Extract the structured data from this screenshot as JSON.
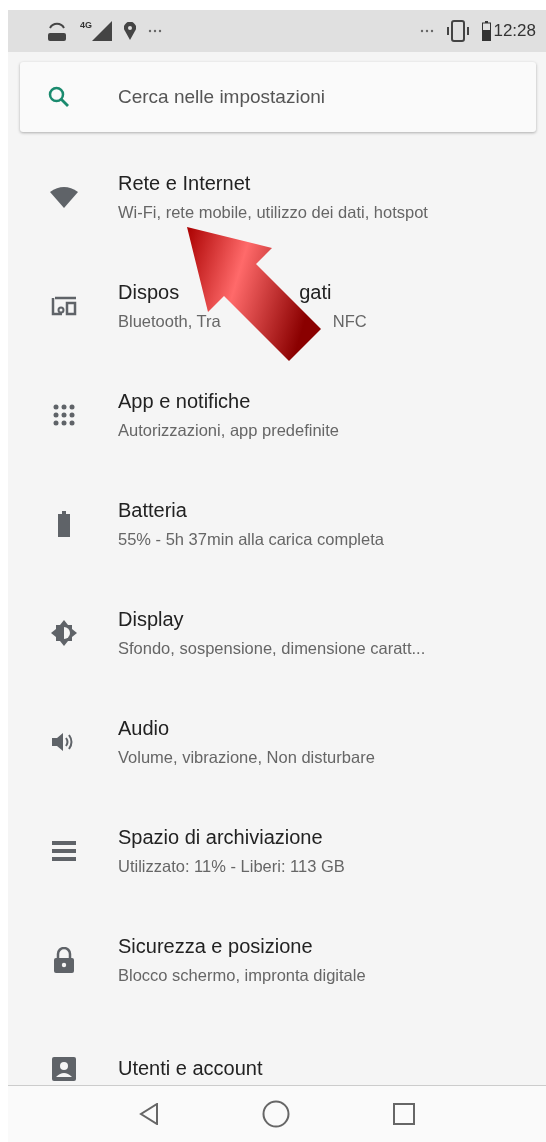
{
  "status_bar": {
    "network": "4G",
    "time": "12:28"
  },
  "search": {
    "placeholder": "Cerca nelle impostazioni"
  },
  "items": [
    {
      "title": [
        "Rete e Internet"
      ],
      "subtitle": [
        "Wi-Fi, rete mobile, utilizzo dei dati, hotspot"
      ]
    },
    {
      "title": [
        "Dispos",
        "gati"
      ],
      "subtitle": [
        "Bluetooth, Tra",
        "NFC"
      ]
    },
    {
      "title": [
        "App e notifiche"
      ],
      "subtitle": [
        "Autorizzazioni, app predefinite"
      ]
    },
    {
      "title": [
        "Batteria"
      ],
      "subtitle": [
        "55% - 5h 37min alla carica completa"
      ]
    },
    {
      "title": [
        "Display"
      ],
      "subtitle": [
        "Sfondo, sospensione, dimensione caratt..."
      ]
    },
    {
      "title": [
        "Audio"
      ],
      "subtitle": [
        "Volume, vibrazione, Non disturbare"
      ]
    },
    {
      "title": [
        "Spazio di archiviazione"
      ],
      "subtitle": [
        "Utilizzato: 11% - Liberi: 113 GB"
      ]
    },
    {
      "title": [
        "Sicurezza e posizione"
      ],
      "subtitle": [
        "Blocco schermo, impronta digitale"
      ]
    },
    {
      "title": [
        "Utenti e account"
      ]
    }
  ],
  "annotation": {
    "kind": "arrow"
  }
}
